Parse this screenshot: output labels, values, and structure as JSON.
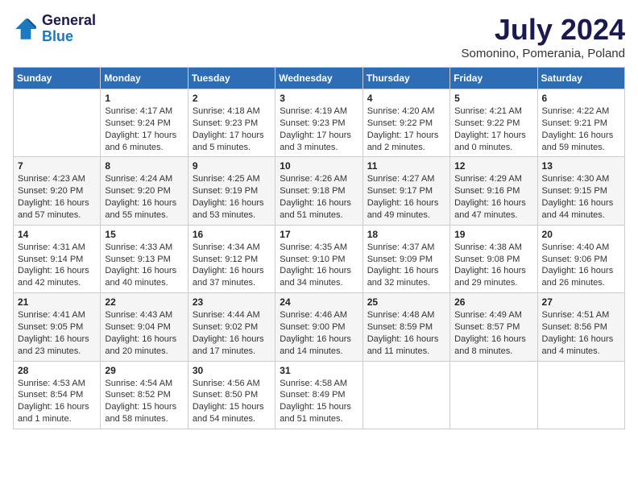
{
  "logo": {
    "line1": "General",
    "line2": "Blue"
  },
  "title": "July 2024",
  "subtitle": "Somonino, Pomerania, Poland",
  "headers": [
    "Sunday",
    "Monday",
    "Tuesday",
    "Wednesday",
    "Thursday",
    "Friday",
    "Saturday"
  ],
  "weeks": [
    [
      {
        "day": "",
        "info": ""
      },
      {
        "day": "1",
        "info": "Sunrise: 4:17 AM\nSunset: 9:24 PM\nDaylight: 17 hours\nand 6 minutes."
      },
      {
        "day": "2",
        "info": "Sunrise: 4:18 AM\nSunset: 9:23 PM\nDaylight: 17 hours\nand 5 minutes."
      },
      {
        "day": "3",
        "info": "Sunrise: 4:19 AM\nSunset: 9:23 PM\nDaylight: 17 hours\nand 3 minutes."
      },
      {
        "day": "4",
        "info": "Sunrise: 4:20 AM\nSunset: 9:22 PM\nDaylight: 17 hours\nand 2 minutes."
      },
      {
        "day": "5",
        "info": "Sunrise: 4:21 AM\nSunset: 9:22 PM\nDaylight: 17 hours\nand 0 minutes."
      },
      {
        "day": "6",
        "info": "Sunrise: 4:22 AM\nSunset: 9:21 PM\nDaylight: 16 hours\nand 59 minutes."
      }
    ],
    [
      {
        "day": "7",
        "info": "Sunrise: 4:23 AM\nSunset: 9:20 PM\nDaylight: 16 hours\nand 57 minutes."
      },
      {
        "day": "8",
        "info": "Sunrise: 4:24 AM\nSunset: 9:20 PM\nDaylight: 16 hours\nand 55 minutes."
      },
      {
        "day": "9",
        "info": "Sunrise: 4:25 AM\nSunset: 9:19 PM\nDaylight: 16 hours\nand 53 minutes."
      },
      {
        "day": "10",
        "info": "Sunrise: 4:26 AM\nSunset: 9:18 PM\nDaylight: 16 hours\nand 51 minutes."
      },
      {
        "day": "11",
        "info": "Sunrise: 4:27 AM\nSunset: 9:17 PM\nDaylight: 16 hours\nand 49 minutes."
      },
      {
        "day": "12",
        "info": "Sunrise: 4:29 AM\nSunset: 9:16 PM\nDaylight: 16 hours\nand 47 minutes."
      },
      {
        "day": "13",
        "info": "Sunrise: 4:30 AM\nSunset: 9:15 PM\nDaylight: 16 hours\nand 44 minutes."
      }
    ],
    [
      {
        "day": "14",
        "info": "Sunrise: 4:31 AM\nSunset: 9:14 PM\nDaylight: 16 hours\nand 42 minutes."
      },
      {
        "day": "15",
        "info": "Sunrise: 4:33 AM\nSunset: 9:13 PM\nDaylight: 16 hours\nand 40 minutes."
      },
      {
        "day": "16",
        "info": "Sunrise: 4:34 AM\nSunset: 9:12 PM\nDaylight: 16 hours\nand 37 minutes."
      },
      {
        "day": "17",
        "info": "Sunrise: 4:35 AM\nSunset: 9:10 PM\nDaylight: 16 hours\nand 34 minutes."
      },
      {
        "day": "18",
        "info": "Sunrise: 4:37 AM\nSunset: 9:09 PM\nDaylight: 16 hours\nand 32 minutes."
      },
      {
        "day": "19",
        "info": "Sunrise: 4:38 AM\nSunset: 9:08 PM\nDaylight: 16 hours\nand 29 minutes."
      },
      {
        "day": "20",
        "info": "Sunrise: 4:40 AM\nSunset: 9:06 PM\nDaylight: 16 hours\nand 26 minutes."
      }
    ],
    [
      {
        "day": "21",
        "info": "Sunrise: 4:41 AM\nSunset: 9:05 PM\nDaylight: 16 hours\nand 23 minutes."
      },
      {
        "day": "22",
        "info": "Sunrise: 4:43 AM\nSunset: 9:04 PM\nDaylight: 16 hours\nand 20 minutes."
      },
      {
        "day": "23",
        "info": "Sunrise: 4:44 AM\nSunset: 9:02 PM\nDaylight: 16 hours\nand 17 minutes."
      },
      {
        "day": "24",
        "info": "Sunrise: 4:46 AM\nSunset: 9:00 PM\nDaylight: 16 hours\nand 14 minutes."
      },
      {
        "day": "25",
        "info": "Sunrise: 4:48 AM\nSunset: 8:59 PM\nDaylight: 16 hours\nand 11 minutes."
      },
      {
        "day": "26",
        "info": "Sunrise: 4:49 AM\nSunset: 8:57 PM\nDaylight: 16 hours\nand 8 minutes."
      },
      {
        "day": "27",
        "info": "Sunrise: 4:51 AM\nSunset: 8:56 PM\nDaylight: 16 hours\nand 4 minutes."
      }
    ],
    [
      {
        "day": "28",
        "info": "Sunrise: 4:53 AM\nSunset: 8:54 PM\nDaylight: 16 hours\nand 1 minute."
      },
      {
        "day": "29",
        "info": "Sunrise: 4:54 AM\nSunset: 8:52 PM\nDaylight: 15 hours\nand 58 minutes."
      },
      {
        "day": "30",
        "info": "Sunrise: 4:56 AM\nSunset: 8:50 PM\nDaylight: 15 hours\nand 54 minutes."
      },
      {
        "day": "31",
        "info": "Sunrise: 4:58 AM\nSunset: 8:49 PM\nDaylight: 15 hours\nand 51 minutes."
      },
      {
        "day": "",
        "info": ""
      },
      {
        "day": "",
        "info": ""
      },
      {
        "day": "",
        "info": ""
      }
    ]
  ]
}
